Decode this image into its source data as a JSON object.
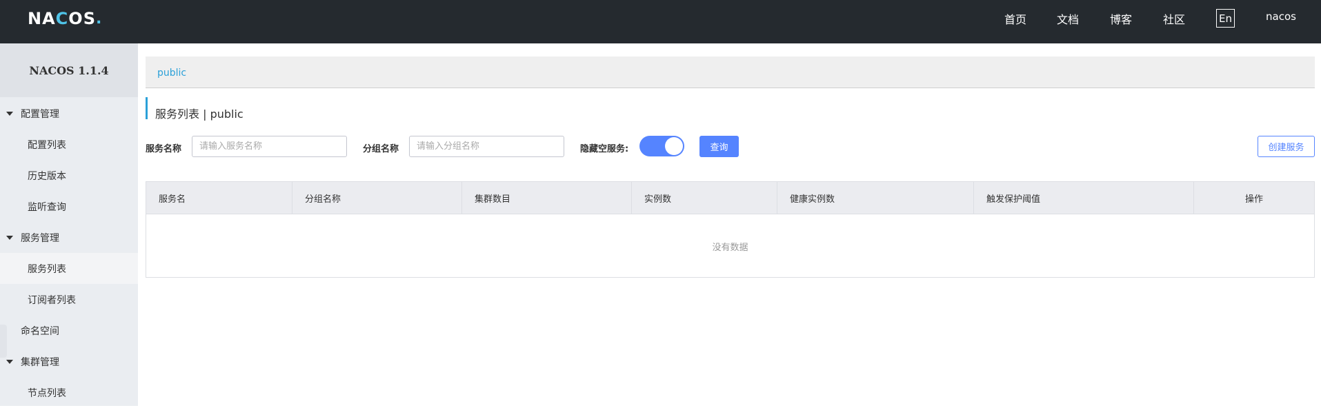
{
  "header": {
    "logo": {
      "part1": "NA",
      "part2": "C",
      "part3": "OS",
      "dot": "."
    },
    "nav": [
      "首页",
      "文档",
      "博客",
      "社区"
    ],
    "lang": "En",
    "user": "nacos"
  },
  "sidebar": {
    "title": "NACOS 1.1.4",
    "items": [
      {
        "label": "配置管理",
        "type": "group"
      },
      {
        "label": "配置列表",
        "type": "sub"
      },
      {
        "label": "历史版本",
        "type": "sub"
      },
      {
        "label": "监听查询",
        "type": "sub"
      },
      {
        "label": "服务管理",
        "type": "group"
      },
      {
        "label": "服务列表",
        "type": "sub",
        "active": true
      },
      {
        "label": "订阅者列表",
        "type": "sub"
      },
      {
        "label": "命名空间",
        "type": "plain"
      },
      {
        "label": "集群管理",
        "type": "group"
      },
      {
        "label": "节点列表",
        "type": "sub"
      }
    ]
  },
  "breadcrumb": "public",
  "page_title": "服务列表 | public",
  "filters": {
    "service_name_label": "服务名称",
    "service_name_placeholder": "请输入服务名称",
    "group_name_label": "分组名称",
    "group_name_placeholder": "请输入分组名称",
    "hide_empty_label": "隐藏空服务:",
    "hide_empty_on": true,
    "query_button": "查询",
    "create_button": "创建服务"
  },
  "table": {
    "columns": [
      "服务名",
      "分组名称",
      "集群数目",
      "实例数",
      "健康实例数",
      "触发保护阈值",
      "操作"
    ],
    "empty_text": "没有数据"
  },
  "colors": {
    "accent": "#5584ff",
    "link": "#2aa0d8",
    "header_bg": "#252a2f"
  }
}
